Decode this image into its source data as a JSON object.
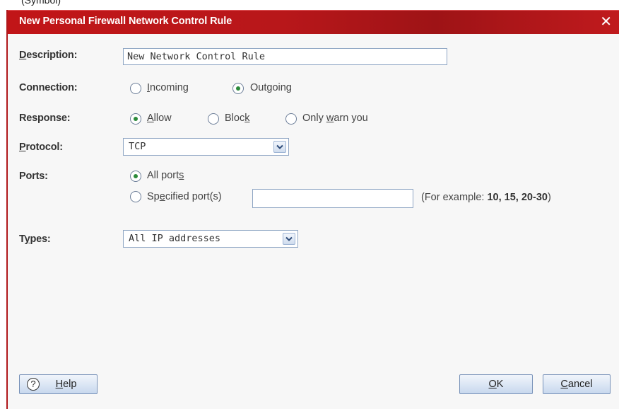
{
  "titlebar": {
    "title": "New Personal Firewall Network Control Rule",
    "close_glyph": "✕"
  },
  "top_strip_text": "(Symbol)",
  "description": {
    "label_first": "D",
    "label_rest": "escription:",
    "value": "New Network Control Rule"
  },
  "connection": {
    "label": "Connection:",
    "incoming": {
      "pre": "",
      "key": "I",
      "post": "ncoming",
      "selected": false
    },
    "outgoing": {
      "pre": "Out",
      "key": "g",
      "post": "oing",
      "selected": true
    }
  },
  "response": {
    "label": "Response:",
    "allow": {
      "pre": "",
      "key": "A",
      "post": "llow",
      "selected": true
    },
    "block": {
      "pre": "Bloc",
      "key": "k",
      "post": "",
      "selected": false
    },
    "warn": {
      "pre": "Only ",
      "key": "w",
      "post": "arn you",
      "selected": false
    }
  },
  "protocol": {
    "label_first": "P",
    "label_rest": "rotocol:",
    "value": "TCP"
  },
  "ports": {
    "label": "Ports:",
    "all": {
      "pre": "All port",
      "key": "s",
      "post": "",
      "selected": true
    },
    "specified": {
      "pre": "Sp",
      "key": "e",
      "post": "cified port(s)",
      "selected": false,
      "value": ""
    },
    "example_pre": "(For example: ",
    "example_values": "10, 15, 20-30",
    "example_post": ")"
  },
  "types": {
    "label_pre": "T",
    "label_key": "y",
    "label_post": "pes:",
    "value": "All IP addresses"
  },
  "buttons": {
    "help": {
      "icon": "?",
      "key": "H",
      "rest": "elp"
    },
    "ok": {
      "key": "O",
      "rest": "K"
    },
    "cancel": {
      "key": "C",
      "rest": "ancel"
    }
  },
  "colors": {
    "titlebar": "#b8171a",
    "radio_dot": "#2b8a3a",
    "button_border": "#7791b8"
  }
}
